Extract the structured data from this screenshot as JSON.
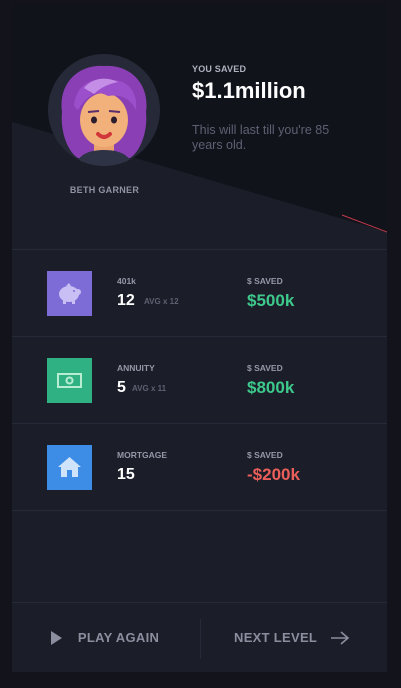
{
  "profile": {
    "name": "BETH GARNER",
    "avatar_icon": "woman-purple-hair-avatar"
  },
  "summary": {
    "label": "YOU SAVED",
    "value": "$1.1million",
    "note": "This will last till you're 85 years old."
  },
  "items": [
    {
      "category": "401k",
      "count": "12",
      "avg": "AVG x 12",
      "saved_label": "$ SAVED",
      "amount": "$500k",
      "icon": "piggy-bank-icon",
      "icon_color": "#7e6cd6",
      "amount_color": "#3ec98c"
    },
    {
      "category": "ANNUITY",
      "count": "5",
      "avg": "AVG x 11",
      "saved_label": "$ SAVED",
      "amount": "$800k",
      "icon": "cash-icon",
      "icon_color": "#2fb184",
      "amount_color": "#3ec98c"
    },
    {
      "category": "MORTGAGE",
      "count": "15",
      "avg": "",
      "saved_label": "$ SAVED",
      "amount": "-$200k",
      "icon": "house-icon",
      "icon_color": "#3d8de6",
      "amount_color": "#ea5f5a"
    }
  ],
  "footer": {
    "play_again": "PLAY AGAIN",
    "next_level": "NEXT LEVEL"
  },
  "colors": {
    "background": "#13141b",
    "card": "#1b1d28",
    "positive": "#3ec98c",
    "negative": "#ea5f5a"
  }
}
